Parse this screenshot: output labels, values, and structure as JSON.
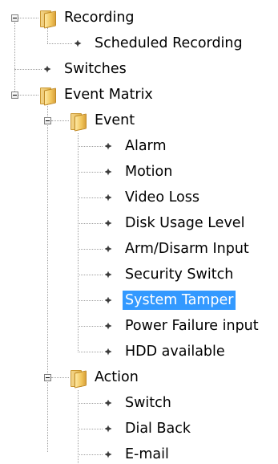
{
  "tree": {
    "rows": [
      {
        "label": "Recording",
        "type": "folder",
        "level": 0,
        "expanded": true,
        "selected": false
      },
      {
        "label": "Scheduled Recording",
        "type": "leaf",
        "level": 1,
        "selected": false
      },
      {
        "label": "Switches",
        "type": "leaf",
        "level": 0,
        "selected": false
      },
      {
        "label": "Event Matrix",
        "type": "folder",
        "level": 0,
        "expanded": true,
        "selected": false
      },
      {
        "label": "Event",
        "type": "folder",
        "level": 1,
        "expanded": true,
        "selected": false
      },
      {
        "label": "Alarm",
        "type": "leaf",
        "level": 2,
        "selected": false
      },
      {
        "label": "Motion",
        "type": "leaf",
        "level": 2,
        "selected": false
      },
      {
        "label": "Video Loss",
        "type": "leaf",
        "level": 2,
        "selected": false
      },
      {
        "label": "Disk Usage Level",
        "type": "leaf",
        "level": 2,
        "selected": false
      },
      {
        "label": "Arm/Disarm Input",
        "type": "leaf",
        "level": 2,
        "selected": false
      },
      {
        "label": "Security Switch",
        "type": "leaf",
        "level": 2,
        "selected": false
      },
      {
        "label": "System Tamper",
        "type": "leaf",
        "level": 2,
        "selected": true
      },
      {
        "label": "Power Failure input",
        "type": "leaf",
        "level": 2,
        "selected": false
      },
      {
        "label": "HDD available",
        "type": "leaf",
        "level": 2,
        "selected": false
      },
      {
        "label": "Action",
        "type": "folder",
        "level": 1,
        "expanded": true,
        "selected": false
      },
      {
        "label": "Switch",
        "type": "leaf",
        "level": 2,
        "selected": false
      },
      {
        "label": "Dial Back",
        "type": "leaf",
        "level": 2,
        "selected": false
      },
      {
        "label": "E-mail",
        "type": "leaf",
        "level": 2,
        "selected": false
      }
    ]
  },
  "colors": {
    "selection_bg": "#3399ff",
    "selection_text": "#ffffff",
    "tree_line": "#a0a0a0",
    "folder": "#f1c45a"
  },
  "icons": {
    "folder": "folder-icon",
    "leaf": "bullet-icon",
    "toggle": "collapse-toggle-icon"
  }
}
